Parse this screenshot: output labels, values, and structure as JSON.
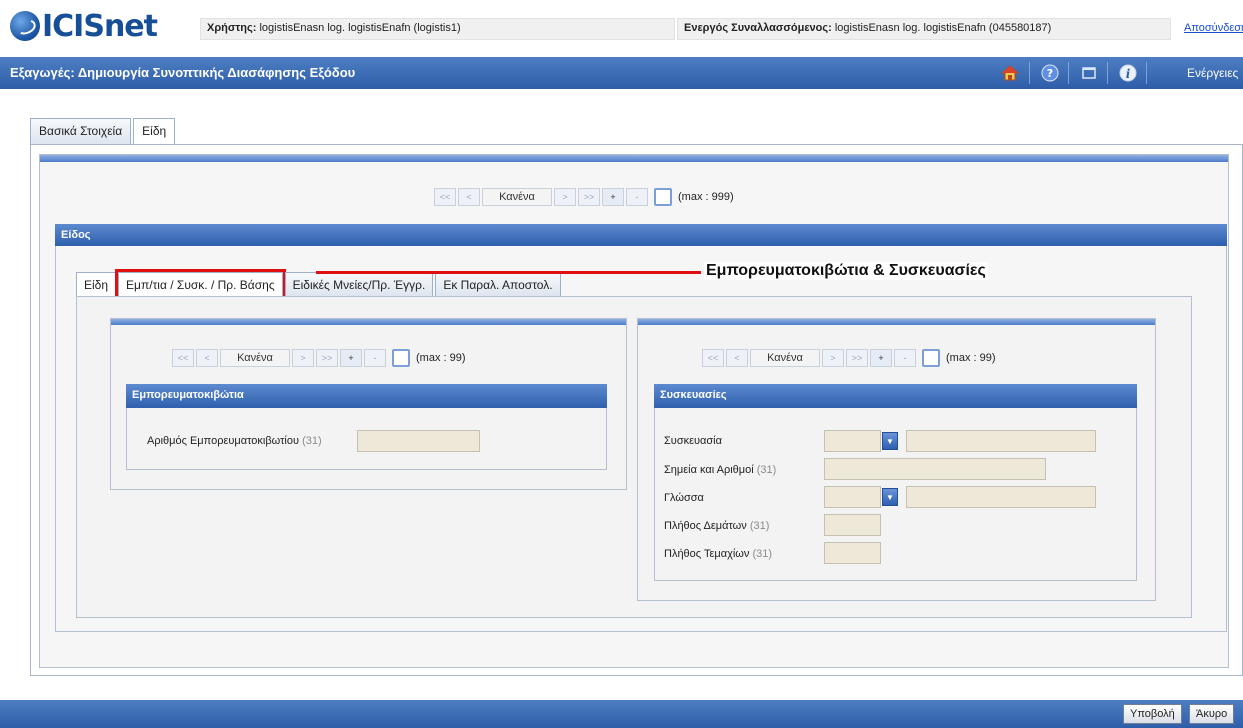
{
  "app": {
    "logo_text": "ICISnet"
  },
  "header": {
    "user_label": "Χρήστης:",
    "user_value": "logistisEnasn log. logistisEnafn (logistis1)",
    "trader_label": "Ενεργός Συναλλασσόμενος:",
    "trader_value": "logistisEnasn log. logistisEnafn (045580187)",
    "logout": "Αποσύνδεση"
  },
  "titlebar": {
    "title": "Εξαγωγές: Δημιουργία Συνοπτικής Διασάφησης Εξόδου",
    "actions": "Ενέργειες",
    "icons": [
      "home-icon",
      "help-icon",
      "window-icon",
      "info-icon"
    ]
  },
  "main_tabs": [
    {
      "label": "Βασικά Στοιχεία"
    },
    {
      "label": "Είδη"
    }
  ],
  "items_pager": {
    "value": "Κανένα",
    "max": "(max : 999)",
    "first": "<<",
    "prev": "<",
    "next": ">",
    "last": ">>",
    "add": "+",
    "remove": "-"
  },
  "item_section": {
    "title": "Είδος"
  },
  "inner_tabs": [
    {
      "label": "Είδη"
    },
    {
      "label": "Εμπ/τια / Συσκ. / Πρ. Βάσης"
    },
    {
      "label": "Ειδικές Μνείες/Πρ. Έγγρ."
    },
    {
      "label": "Εκ Παραλ. Αποστολ."
    }
  ],
  "callout": {
    "text": "Εμπορευματοκιβώτια & Συσκευασίες"
  },
  "containers": {
    "pager": {
      "value": "Κανένα",
      "max": "(max : 99)",
      "first": "<<",
      "prev": "<",
      "next": ">",
      "last": ">>",
      "add": "+",
      "remove": "-"
    },
    "title": "Εμπορευματοκιβώτια",
    "field_label": "Αριθμός Εμπορευματοκιβωτίου",
    "field_hint": "(31)",
    "field_value": ""
  },
  "packages": {
    "pager": {
      "value": "Κανένα",
      "max": "(max : 99)",
      "first": "<<",
      "prev": "<",
      "next": ">",
      "last": ">>",
      "add": "+",
      "remove": "-"
    },
    "title": "Συσκευασίες",
    "fields": {
      "package_label": "Συσκευασία",
      "marks_label": "Σημεία και Αριθμοί",
      "marks_hint": "(31)",
      "language_label": "Γλώσσα",
      "bales_label": "Πλήθος Δεμάτων",
      "bales_hint": "(31)",
      "pieces_label": "Πλήθος Τεμαχίων",
      "pieces_hint": "(31)"
    }
  },
  "footer": {
    "submit": "Υποβολή",
    "cancel": "Άκυρο"
  },
  "colors": {
    "accent": "#2e5ea8",
    "highlight": "#e01010",
    "input_bg": "#eee8d8"
  }
}
